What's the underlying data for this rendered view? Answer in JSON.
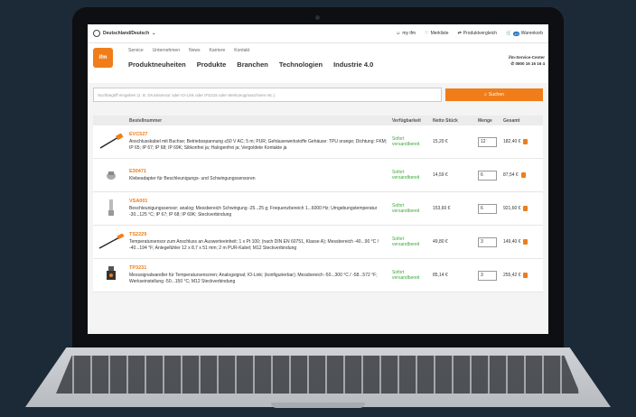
{
  "topbar": {
    "region": "Deutschland/Deutsch",
    "my_ifm": "my ifm",
    "watchlist": "Merkliste",
    "compare": "Produktvergleich",
    "basket": "Warenkorb",
    "basket_count": "10"
  },
  "logo": {
    "text": "ifm"
  },
  "subnav": [
    "Service",
    "Unternehmen",
    "News",
    "Karriere",
    "Kontakt"
  ],
  "mainnav": [
    "Produktneuheiten",
    "Produkte",
    "Branchen",
    "Technologien",
    "Industrie 4.0"
  ],
  "service_center": {
    "title": "ifm-Service-Center",
    "phone": "0800 16 16 16 4"
  },
  "search": {
    "placeholder": "Suchbegriff eingeben (z. B. Drucksensor oder IO-Link oder IFS215 oder Werkzeugmaschinen etc.)",
    "button": "Suchen"
  },
  "table": {
    "headers": {
      "order_no": "Bestellnummer",
      "availability": "Verfügbarkeit",
      "net": "Netto Stück",
      "qty": "Menge",
      "total": "Gesamt"
    },
    "rows": [
      {
        "sku": "EVC527",
        "desc": "Anschlusskabel mit Buchse; Betriebsspannung ≤50 V AC; 5 m; PUR; Gehäusewerkstoffe Gehäuse: TPU orange; Dichtung: FKM; IP 65; IP 67; IP 68; IP 69K; Silikonfrei ja; Halogenfrei ja; Vergoldete Kontakte ja",
        "avail": "Sofort versandbereit",
        "price": "15,20 €",
        "qty": "12",
        "total": "182,40 €"
      },
      {
        "sku": "E30471",
        "desc": "Klebeadapter für Beschleunigungs- und Schwingungssensoren",
        "avail": "Sofort versandbereit",
        "price": "14,59 €",
        "qty": "6",
        "total": "87,54 €"
      },
      {
        "sku": "VSA001",
        "desc": "Beschleunigungssensor; analog; Messbereich Schwingung -25...25 g; Frequenzbereich 1...6000 Hz; Umgebungstemperatur -30...125 °C; IP 67; IP 68; IP 69K; Steckverbindung",
        "avail": "Sofort versandbereit",
        "price": "153,60 €",
        "qty": "6",
        "total": "921,60 €"
      },
      {
        "sku": "TS2229",
        "desc": "Temperatursensor zum Anschluss an Auswerteeinheit; 1 x Pt 100; (nach DIN EN 60751, Klasse A); Messbereich -40...90 °C / -40...194 °F; Anlegefühler 12 x 8,7 x 51 mm; 2 m PUR-Kabel; M12 Steckverbindung",
        "avail": "Sofort versandbereit",
        "price": "49,80 €",
        "qty": "3",
        "total": "149,40 €"
      },
      {
        "sku": "TP3231",
        "desc": "Messsignalwandler für Temperatursensoren; Analogsignal; IO-Link; (konfigurierbar); Messbereich -50...300 °C / -58...572 °F; Werkseinstellung -50...150 °C; M12 Steckverbindung",
        "avail": "Sofort versandbereit",
        "price": "85,14 €",
        "qty": "3",
        "total": "255,42 €"
      }
    ]
  },
  "colors": {
    "accent": "#f07d1a",
    "available": "#3aaa35"
  }
}
